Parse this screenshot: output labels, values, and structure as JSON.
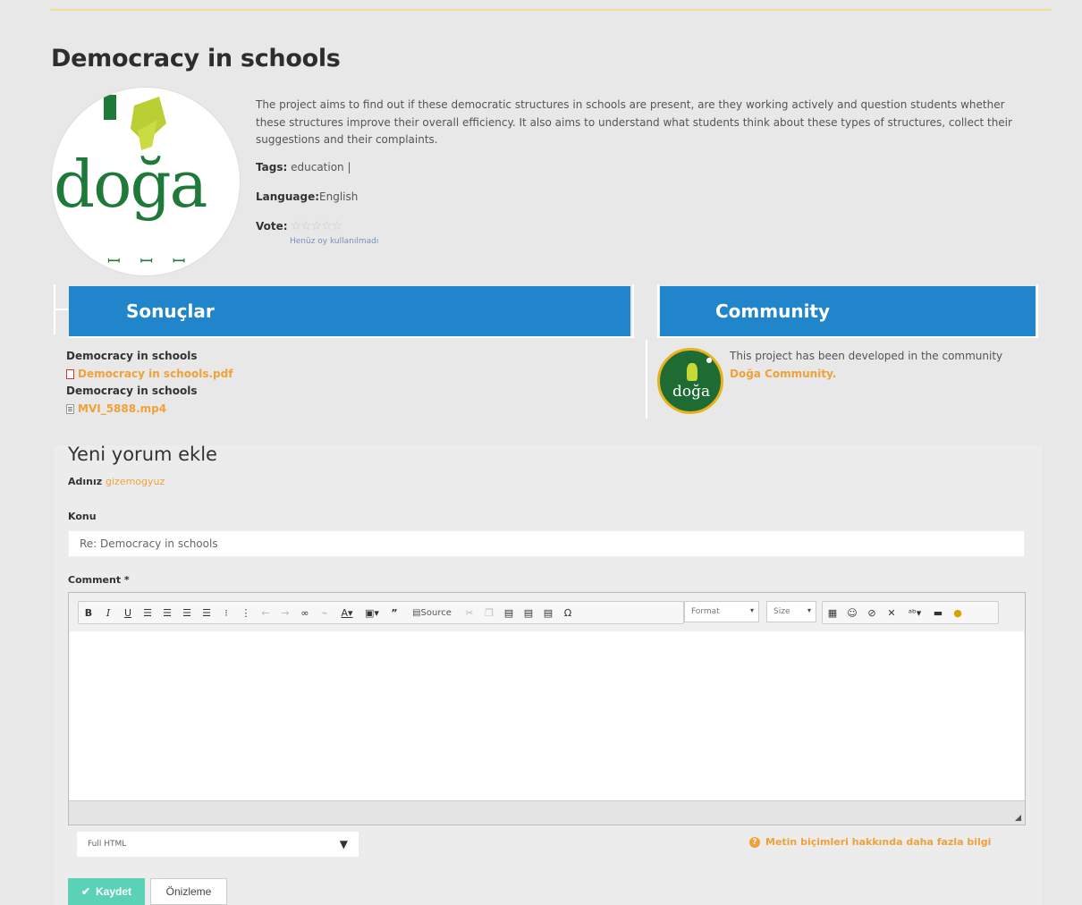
{
  "project": {
    "title": "Democracy in schools",
    "description": "The project aims to find out if these democratic structures in schools are present, are they working actively and question students whether these structures improve their overall efficiency. It also aims to understand what students think about these types of structures, collect their suggestions and their complaints.",
    "tags_label": "Tags:",
    "tags_value": "education |",
    "language_label": "Language:",
    "language_value": "English",
    "vote_label": "Vote:",
    "vote_note": "Henüz oy kullanılmadı",
    "logo_text": "doğa"
  },
  "sections": {
    "results_title": "Sonuçlar",
    "community_title": "Community",
    "results": [
      {
        "title": "Democracy in schools",
        "file": "Democracy in schools.pdf",
        "type": "pdf"
      },
      {
        "title": "Democracy in schools",
        "file": "MVI_5888.mp4",
        "type": "video"
      }
    ],
    "community_text": "This project has been developed in the community",
    "community_link": "Doğa Community",
    "community_logo_text": "doğa"
  },
  "form": {
    "title": "Yeni yorum ekle",
    "name_label": "Adınız",
    "name_value": "gizemogyuz",
    "subject_label": "Konu",
    "subject_value": "Re: Democracy in schools",
    "comment_label": "Comment *",
    "toolbar": {
      "format_label": "Format",
      "size_label": "Size",
      "source_label": "Source"
    },
    "text_format": "Full HTML",
    "more_info": "Metin biçimleri hakkında daha fazla bilgi",
    "save_label": "Kaydet",
    "preview_label": "Önizleme"
  },
  "colors": {
    "accent": "#2185cc",
    "link": "#f0a138",
    "save": "#5bd1b6"
  }
}
